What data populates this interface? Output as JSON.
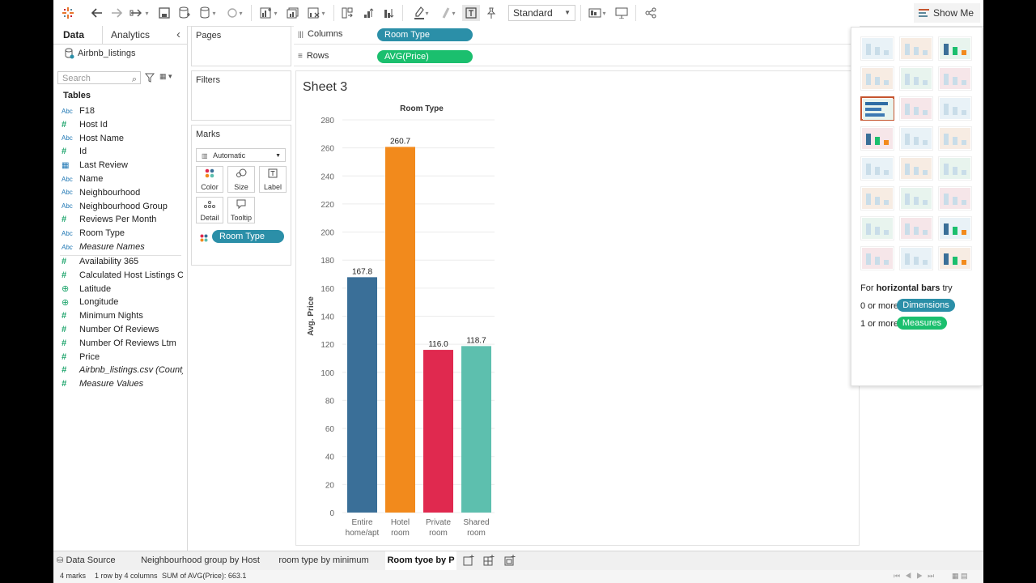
{
  "toolbar": {
    "fit_select": "Standard",
    "show_me_label": "Show Me"
  },
  "data_pane": {
    "tab_data": "Data",
    "tab_analytics": "Analytics",
    "collapse_glyph": "‹",
    "source_name": "Airbnb_listings",
    "search_placeholder": "Search",
    "tables_header": "Tables",
    "dimensions": [
      {
        "type": "Abc",
        "label": "F18"
      },
      {
        "type": "#",
        "label": "Host Id"
      },
      {
        "type": "Abc",
        "label": "Host Name"
      },
      {
        "type": "#",
        "label": "Id"
      },
      {
        "type": "cal",
        "label": "Last Review"
      },
      {
        "type": "Abc",
        "label": "Name"
      },
      {
        "type": "Abc",
        "label": "Neighbourhood"
      },
      {
        "type": "Abc",
        "label": "Neighbourhood Group"
      },
      {
        "type": "#",
        "label": "Reviews Per Month"
      },
      {
        "type": "Abc",
        "label": "Room Type"
      },
      {
        "type": "Abc",
        "label": "Measure Names"
      }
    ],
    "measures": [
      {
        "type": "#",
        "label": "Availability 365"
      },
      {
        "type": "#",
        "label": "Calculated Host Listings C..."
      },
      {
        "type": "globe",
        "label": "Latitude"
      },
      {
        "type": "globe",
        "label": "Longitude"
      },
      {
        "type": "#",
        "label": "Minimum Nights"
      },
      {
        "type": "#",
        "label": "Number Of Reviews"
      },
      {
        "type": "#",
        "label": "Number Of Reviews Ltm"
      },
      {
        "type": "#",
        "label": "Price"
      },
      {
        "type": "#",
        "label": "Airbnb_listings.csv (Count)"
      },
      {
        "type": "#",
        "label": "Measure Values"
      }
    ]
  },
  "cards": {
    "pages_title": "Pages",
    "filters_title": "Filters",
    "marks_title": "Marks",
    "marks_type": "Automatic",
    "mark_buttons": [
      "Color",
      "Size",
      "Label",
      "Detail",
      "Tooltip"
    ],
    "color_pill": "Room Type"
  },
  "shelves": {
    "columns_label": "Columns",
    "columns_pill": "Room Type",
    "rows_label": "Rows",
    "rows_pill": "AVG(Price)"
  },
  "sheet": {
    "title": "Sheet 3"
  },
  "chart_data": {
    "type": "bar",
    "title": "Room Type",
    "ylabel": "Avg. Price",
    "categories": [
      "Entire home/apt",
      "Hotel room",
      "Private room",
      "Shared room"
    ],
    "category_lines": [
      [
        "Entire",
        "home/apt"
      ],
      [
        "Hotel",
        "room"
      ],
      [
        "Private",
        "room"
      ],
      [
        "Shared",
        "room"
      ]
    ],
    "values": [
      167.8,
      260.7,
      116.0,
      118.7
    ],
    "value_labels": [
      "167.8",
      "260.7",
      "116.0",
      "118.7"
    ],
    "colors": [
      "#3a6f98",
      "#f28a1c",
      "#e0294f",
      "#5dbfae"
    ],
    "ylim": [
      0,
      280
    ],
    "yticks": [
      0,
      20,
      40,
      60,
      80,
      100,
      120,
      140,
      160,
      180,
      200,
      220,
      240,
      260,
      280
    ],
    "grid": true
  },
  "show_me": {
    "hint_prefix": "For ",
    "hint_bold": "horizontal bars",
    "hint_suffix": " try",
    "req1_text": "0 or more",
    "req1_pill": "Dimensions",
    "req2_text": "1 or more",
    "req2_pill": "Measures"
  },
  "sheet_tabs": {
    "data_source": "Data Source",
    "tabs": [
      "Neighbourhood group by Host list",
      "room type by minimum nights",
      "Room tyoe by P"
    ]
  },
  "status": {
    "marks": "4 marks",
    "rows_cols": "1 row by 4 columns",
    "sum": "SUM of AVG(Price): 663.1"
  }
}
